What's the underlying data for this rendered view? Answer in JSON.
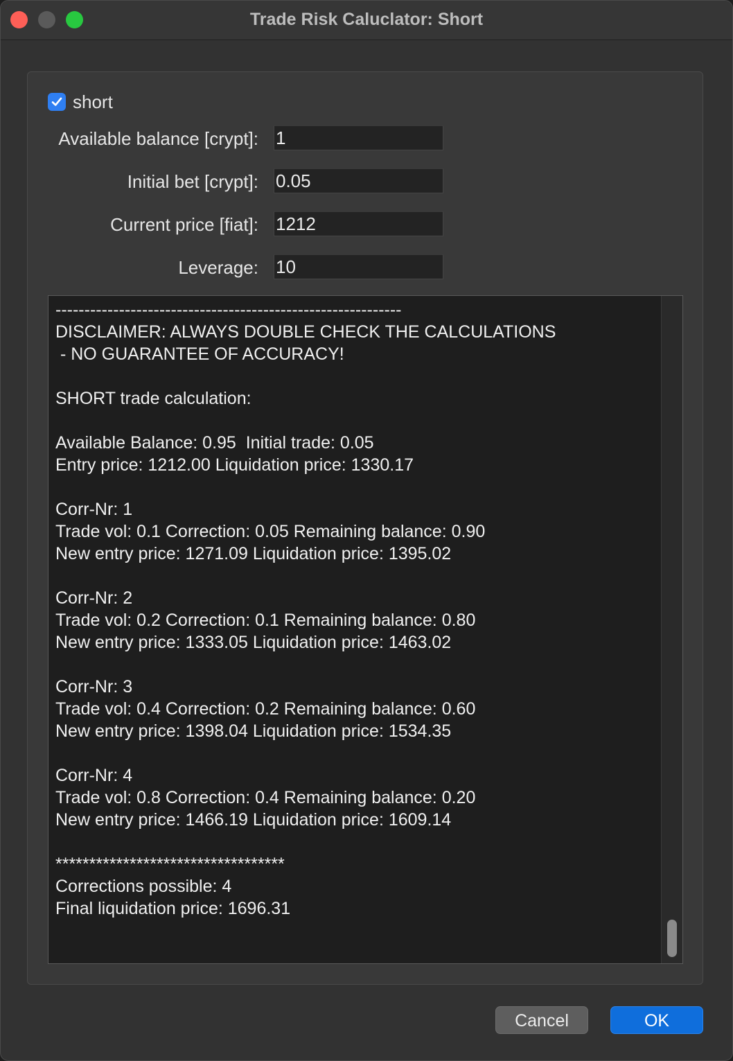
{
  "window": {
    "title": "Trade Risk Caluclator: Short"
  },
  "form": {
    "short_checkbox": {
      "label": "short",
      "checked": true
    },
    "fields": [
      {
        "label": "Available balance [crypt]:",
        "value": "1"
      },
      {
        "label": "Initial bet [crypt]:",
        "value": "0.05"
      },
      {
        "label": "Current price [fiat]:",
        "value": "1212"
      },
      {
        "label": "Leverage:",
        "value": "10"
      }
    ]
  },
  "output": {
    "lines": [
      "------------------------------------------------------------",
      "DISCLAIMER: ALWAYS DOUBLE CHECK THE CALCULATIONS",
      " - NO GUARANTEE OF ACCURACY!",
      "",
      "SHORT trade calculation:",
      "",
      "Available Balance: 0.95  Initial trade: 0.05",
      "Entry price: 1212.00 Liquidation price: 1330.17",
      "",
      "Corr-Nr: 1",
      "Trade vol: 0.1 Correction: 0.05 Remaining balance: 0.90",
      "New entry price: 1271.09 Liquidation price: 1395.02",
      "",
      "Corr-Nr: 2",
      "Trade vol: 0.2 Correction: 0.1 Remaining balance: 0.80",
      "New entry price: 1333.05 Liquidation price: 1463.02",
      "",
      "Corr-Nr: 3",
      "Trade vol: 0.4 Correction: 0.2 Remaining balance: 0.60",
      "New entry price: 1398.04 Liquidation price: 1534.35",
      "",
      "Corr-Nr: 4",
      "Trade vol: 0.8 Correction: 0.4 Remaining balance: 0.20",
      "New entry price: 1466.19 Liquidation price: 1609.14",
      "",
      "**********************************",
      "Corrections possible: 4",
      "Final liquidation price: 1696.31"
    ]
  },
  "buttons": {
    "cancel_label": "Cancel",
    "ok_label": "OK"
  },
  "colors": {
    "accent": "#0f6edc",
    "checkbox": "#2f7ff2",
    "close": "#fe5f57",
    "maximize": "#28c840"
  },
  "icons": {
    "checkbox_mark": "checkmark-icon"
  }
}
